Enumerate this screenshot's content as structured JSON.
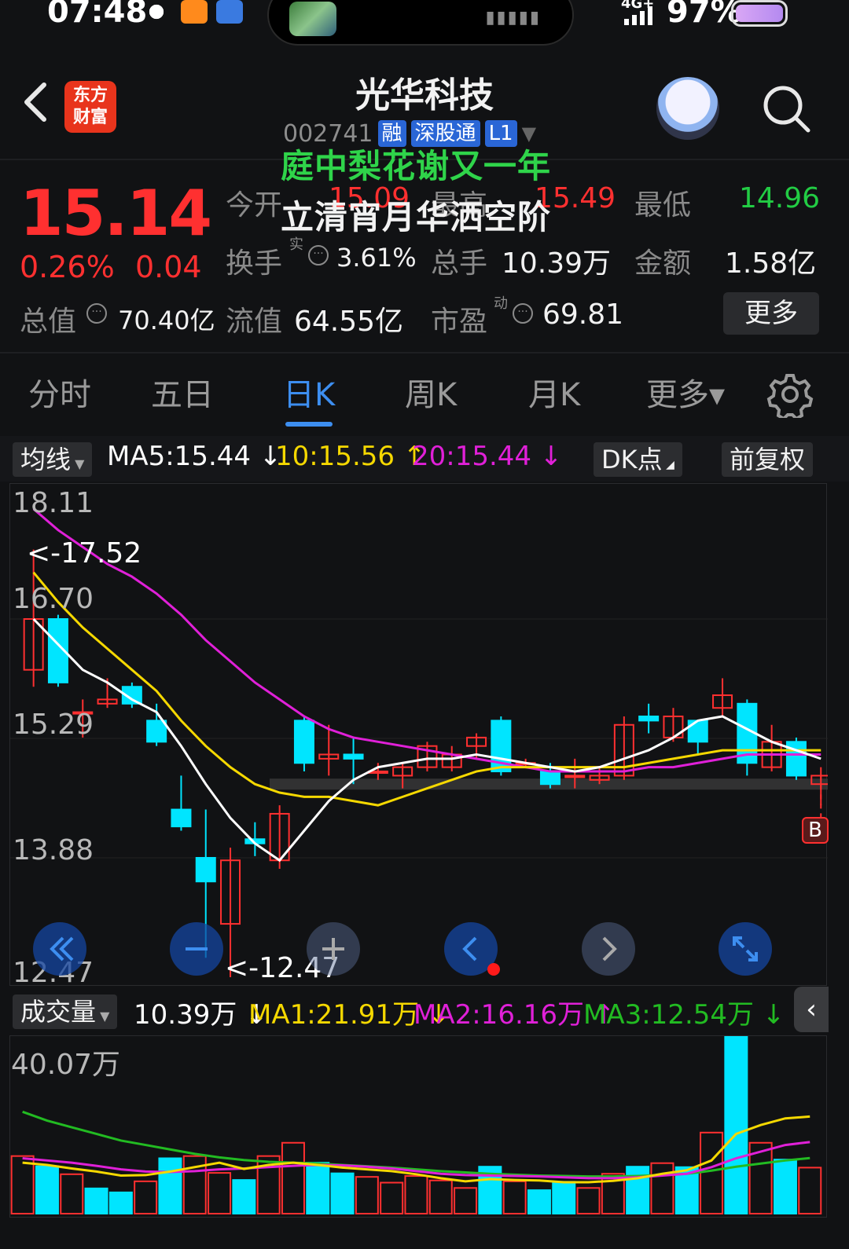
{
  "status": {
    "time": "07:48",
    "network": "4G+",
    "battery": "97%"
  },
  "header": {
    "app_logo": "东方\n财富",
    "stock_name": "光华科技",
    "stock_code": "002741",
    "tags": [
      "融",
      "深股通",
      "L1"
    ],
    "overlay_line1": "庭中梨花谢又一年",
    "overlay_line2": "立清宵月华洒空阶"
  },
  "quote": {
    "price": "15.14",
    "change_pct": "0.26%",
    "change_amt": "0.04",
    "open_label": "今开",
    "open_value": "15.09",
    "high_label": "最高",
    "high_value": "15.49",
    "low_label": "最低",
    "low_value": "14.96",
    "turnover_label": "换手",
    "turnover_sup": "实",
    "turnover_value": "3.61%",
    "volume_label": "总手",
    "volume_value": "10.39万",
    "amount_label": "金额",
    "amount_value": "1.58亿",
    "mktcap_label": "总值",
    "mktcap_value": "70.40亿",
    "float_label": "流值",
    "float_value": "64.55亿",
    "pe_label": "市盈",
    "pe_sup": "动",
    "pe_value": "69.81",
    "more_label": "更多"
  },
  "tabs": [
    {
      "label": "分时"
    },
    {
      "label": "五日"
    },
    {
      "label": "日K",
      "active": true
    },
    {
      "label": "周K"
    },
    {
      "label": "月K"
    },
    {
      "label": "更多▾"
    }
  ],
  "indicator_bar": {
    "selector": "均线",
    "ma5": "MA5:15.44 ↓",
    "ma10": "10:15.56 ↑",
    "ma20": "20:15.44 ↓",
    "dk_label": "DK点",
    "adjust_label": "前复权"
  },
  "colors": {
    "up": "#ff3030",
    "down": "#00e5ff",
    "ma5": "#ffffff",
    "ma10": "#f5d800",
    "ma20": "#e020d8",
    "ma3": "#22bb22",
    "accent": "#3d8ef0"
  },
  "chart_data": [
    {
      "type": "candlestick",
      "y_ticks": [
        "18.11",
        "16.70",
        "15.29",
        "13.88",
        "12.47"
      ],
      "high_marker": "<-17.52",
      "low_marker": "<-12.47",
      "signal_marker": "B",
      "ohlc": [
        {
          "o": 16.1,
          "h": 17.52,
          "c": 16.7,
          "l": 15.9
        },
        {
          "o": 16.7,
          "h": 16.75,
          "c": 15.95,
          "l": 15.9
        },
        {
          "o": 15.6,
          "h": 15.75,
          "c": 15.6,
          "l": 15.3
        },
        {
          "o": 15.7,
          "h": 16.0,
          "c": 15.75,
          "l": 15.65
        },
        {
          "o": 15.9,
          "h": 15.95,
          "c": 15.7,
          "l": 15.65
        },
        {
          "o": 15.5,
          "h": 15.7,
          "c": 15.25,
          "l": 15.2
        },
        {
          "o": 14.45,
          "h": 14.85,
          "c": 14.25,
          "l": 14.2
        },
        {
          "o": 13.88,
          "h": 14.45,
          "c": 13.6,
          "l": 12.7
        },
        {
          "o": 13.1,
          "h": 14.0,
          "c": 13.85,
          "l": 12.47
        },
        {
          "o": 14.1,
          "h": 14.3,
          "c": 14.05,
          "l": 13.9
        },
        {
          "o": 13.85,
          "h": 14.5,
          "c": 14.4,
          "l": 13.75
        },
        {
          "o": 15.5,
          "h": 15.55,
          "c": 15.0,
          "l": 14.9
        },
        {
          "o": 15.05,
          "h": 15.45,
          "c": 15.1,
          "l": 14.85
        },
        {
          "o": 15.1,
          "h": 15.3,
          "c": 15.05,
          "l": 14.75
        },
        {
          "o": 14.9,
          "h": 15.0,
          "c": 14.9,
          "l": 14.8
        },
        {
          "o": 14.85,
          "h": 15.0,
          "c": 14.95,
          "l": 14.7
        },
        {
          "o": 14.95,
          "h": 15.25,
          "c": 15.2,
          "l": 14.9
        },
        {
          "o": 14.95,
          "h": 15.2,
          "c": 15.1,
          "l": 14.9
        },
        {
          "o": 15.2,
          "h": 15.35,
          "c": 15.3,
          "l": 15.05
        },
        {
          "o": 15.5,
          "h": 15.55,
          "c": 14.9,
          "l": 14.85
        },
        {
          "o": 15.0,
          "h": 15.05,
          "c": 15.0,
          "l": 14.95
        },
        {
          "o": 14.9,
          "h": 15.0,
          "c": 14.75,
          "l": 14.7
        },
        {
          "o": 14.85,
          "h": 15.05,
          "c": 14.85,
          "l": 14.7
        },
        {
          "o": 14.8,
          "h": 14.95,
          "c": 14.85,
          "l": 14.75
        },
        {
          "o": 14.85,
          "h": 15.55,
          "c": 15.45,
          "l": 14.8
        },
        {
          "o": 15.55,
          "h": 15.7,
          "c": 15.5,
          "l": 15.35
        },
        {
          "o": 15.3,
          "h": 15.65,
          "c": 15.55,
          "l": 15.25
        },
        {
          "o": 15.5,
          "h": 15.5,
          "c": 15.25,
          "l": 15.1
        },
        {
          "o": 15.65,
          "h": 16.0,
          "c": 15.8,
          "l": 15.55
        },
        {
          "o": 15.7,
          "h": 15.75,
          "c": 15.0,
          "l": 14.85
        },
        {
          "o": 14.95,
          "h": 15.45,
          "c": 15.25,
          "l": 14.9
        },
        {
          "o": 15.25,
          "h": 15.3,
          "c": 14.85,
          "l": 14.8
        },
        {
          "o": 14.75,
          "h": 14.95,
          "c": 14.85,
          "l": 14.5
        }
      ],
      "ma5": [
        16.7,
        16.4,
        16.1,
        15.95,
        15.75,
        15.6,
        15.2,
        14.75,
        14.35,
        14.05,
        13.85,
        14.2,
        14.55,
        14.8,
        14.95,
        15.0,
        15.05,
        15.05,
        15.1,
        15.05,
        15.0,
        14.95,
        14.9,
        14.95,
        15.05,
        15.15,
        15.3,
        15.5,
        15.55,
        15.4,
        15.25,
        15.15,
        15.05
      ],
      "ma10": [
        17.25,
        16.9,
        16.6,
        16.35,
        16.1,
        15.85,
        15.5,
        15.2,
        14.95,
        14.75,
        14.65,
        14.6,
        14.6,
        14.55,
        14.5,
        14.6,
        14.7,
        14.8,
        14.9,
        14.95,
        14.95,
        14.95,
        14.95,
        14.95,
        14.95,
        15.0,
        15.05,
        15.1,
        15.15,
        15.15,
        15.15,
        15.15,
        15.15
      ],
      "ma20": [
        18.0,
        17.75,
        17.55,
        17.35,
        17.2,
        17.0,
        16.75,
        16.45,
        16.2,
        15.95,
        15.75,
        15.55,
        15.4,
        15.3,
        15.25,
        15.2,
        15.15,
        15.1,
        15.05,
        15.0,
        14.95,
        14.9,
        14.9,
        14.9,
        14.9,
        14.95,
        14.95,
        15.0,
        15.05,
        15.1,
        15.1,
        15.1,
        15.1
      ]
    },
    {
      "type": "bar",
      "title": "成交量",
      "y_tick": "40.07万",
      "current": "10.39万 ↓",
      "ma1": "MA1:21.91万 ↓",
      "ma2": "MA2:16.16万 ↑",
      "ma3": "MA3:12.54万 ↓",
      "values": [
        13.0,
        10.7,
        8.9,
        5.7,
        4.8,
        7.3,
        12.5,
        13.0,
        9.2,
        7.6,
        13.0,
        16.0,
        11.5,
        9.1,
        8.3,
        7.0,
        8.5,
        7.5,
        5.8,
        10.6,
        7.3,
        5.3,
        7.2,
        5.8,
        9.0,
        10.6,
        11.4,
        10.5,
        18.3,
        40.07,
        16.0,
        12.2,
        10.39
      ],
      "up": [
        true,
        false,
        true,
        false,
        false,
        true,
        false,
        true,
        true,
        false,
        true,
        true,
        false,
        false,
        true,
        true,
        true,
        true,
        true,
        false,
        true,
        false,
        false,
        true,
        true,
        false,
        true,
        false,
        true,
        false,
        true,
        false,
        true
      ],
      "ma1_values": [
        11.5,
        11.0,
        10.2,
        9.5,
        8.6,
        8.7,
        9.5,
        10.5,
        11.5,
        10.1,
        11.0,
        11.5,
        11.0,
        10.4,
        10.0,
        9.6,
        8.9,
        8.0,
        7.3,
        7.8,
        7.6,
        7.5,
        7.1,
        7.1,
        7.4,
        8.0,
        9.0,
        9.8,
        12.0,
        18.0,
        20.0,
        21.5,
        21.91
      ],
      "ma2_values": [
        12.5,
        12.0,
        11.5,
        10.8,
        10.0,
        9.5,
        9.4,
        9.6,
        10.0,
        10.2,
        10.5,
        10.8,
        11.0,
        10.9,
        10.6,
        10.2,
        9.6,
        9.0,
        8.7,
        8.6,
        8.5,
        8.4,
        8.2,
        8.0,
        8.0,
        8.2,
        8.6,
        9.0,
        10.5,
        12.5,
        14.0,
        15.5,
        16.16
      ],
      "ma3_values": [
        23.0,
        21.0,
        19.5,
        18.0,
        16.5,
        15.5,
        14.5,
        13.5,
        12.7,
        12.1,
        11.7,
        11.5,
        11.3,
        11.0,
        10.7,
        10.4,
        10.0,
        9.6,
        9.3,
        9.0,
        8.8,
        8.6,
        8.5,
        8.4,
        8.4,
        8.5,
        8.7,
        9.0,
        9.7,
        10.6,
        11.3,
        12.0,
        12.54
      ]
    }
  ]
}
